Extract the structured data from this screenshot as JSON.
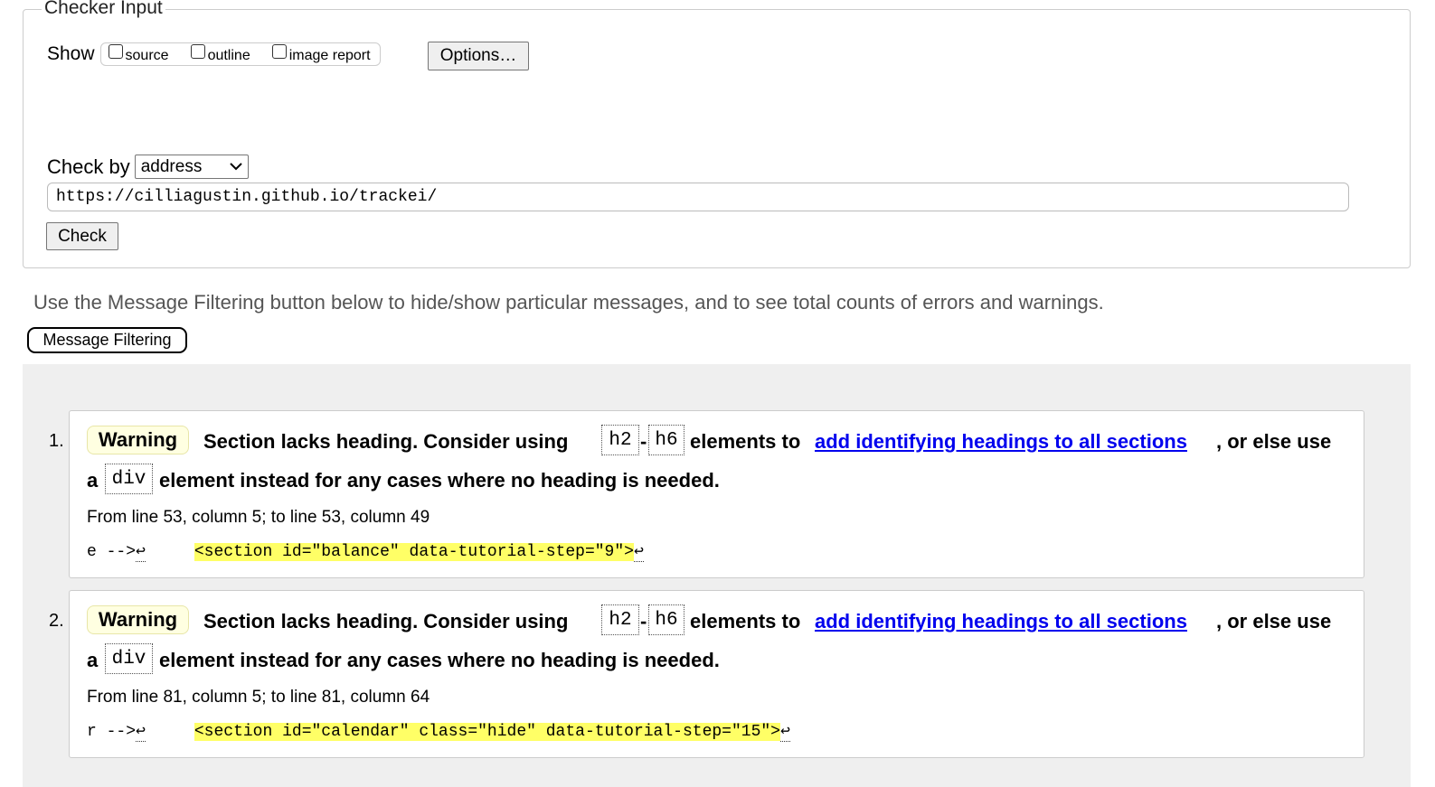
{
  "checker": {
    "legend": "Checker Input",
    "show_label": "Show",
    "show_options": [
      {
        "label": "source",
        "checked": false
      },
      {
        "label": "outline",
        "checked": false
      },
      {
        "label": "image report",
        "checked": false
      }
    ],
    "options_button": "Options…",
    "check_by_label": "Check by",
    "check_by_value": "address",
    "url": "https://cilliagustin.github.io/trackei/",
    "check_button": "Check"
  },
  "info_text": "Use the Message Filtering button below to hide/show particular messages, and to see total counts of errors and warnings.",
  "filter_button": "Message Filtering",
  "messages": [
    {
      "number": "1.",
      "type": "Warning",
      "text_before": "Section lacks heading. Consider using",
      "code_a": "h2",
      "dash": "-",
      "code_b": "h6",
      "text_middle": "elements to",
      "link": "add identifying headings to all sections",
      "text_after": ", or else use",
      "line2_start": "a",
      "code_c": "div",
      "line2_end": "element instead for any cases where no heading is needed.",
      "location": "From line 53, column 5; to line 53, column 49",
      "extract_prefix": "e -->",
      "extract_highlight": "<section id=\"balance\" data-tutorial-step=\"9\">",
      "return_symbol": "↩"
    },
    {
      "number": "2.",
      "type": "Warning",
      "text_before": "Section lacks heading. Consider using",
      "code_a": "h2",
      "dash": "-",
      "code_b": "h6",
      "text_middle": "elements to",
      "link": "add identifying headings to all sections",
      "text_after": ", or else use",
      "line2_start": "a",
      "code_c": "div",
      "line2_end": "element instead for any cases where no heading is needed.",
      "location": "From line 81, column 5; to line 81, column 64",
      "extract_prefix": "r -->",
      "extract_highlight": "<section id=\"calendar\" class=\"hide\" data-tutorial-step=\"15\">",
      "return_symbol": "↩"
    }
  ]
}
